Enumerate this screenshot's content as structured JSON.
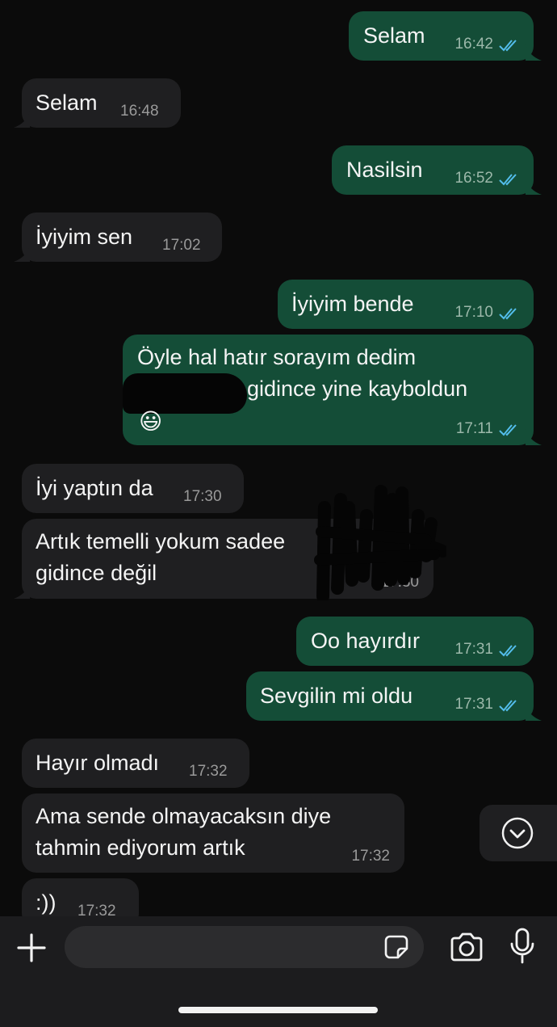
{
  "messages": [
    {
      "dir": "out",
      "text": "Selam",
      "time": "16:42"
    },
    {
      "dir": "in",
      "text": "Selam",
      "time": "16:48"
    },
    {
      "dir": "out",
      "text": "Nasilsin",
      "time": "16:52"
    },
    {
      "dir": "in",
      "text": "İyiyim sen",
      "time": "17:02"
    },
    {
      "dir": "out",
      "text": "İyiyim bende",
      "time": "17:10"
    },
    {
      "dir": "out",
      "line1": "Öyle hal hatır sorayım dedim",
      "line2": "gidince yine kayboldun",
      "emoji": "😃",
      "time": "17:11"
    },
    {
      "dir": "in",
      "text": "İyi yaptın da",
      "time": "17:30"
    },
    {
      "dir": "in",
      "line1": "Artık temelli yokum sadee",
      "line2": "gidince değil",
      "time": "17:30"
    },
    {
      "dir": "out",
      "text": "Oo hayırdır",
      "time": "17:31"
    },
    {
      "dir": "out",
      "text": "Sevgilin mi oldu",
      "time": "17:31"
    },
    {
      "dir": "in",
      "text": "Hayır olmadı",
      "time": "17:32"
    },
    {
      "dir": "in",
      "line1": "Ama sende olmayacaksın diye",
      "line2": "tahmin ediyorum artık",
      "time": "17:32"
    },
    {
      "dir": "in",
      "text": ":))",
      "time": "17:32"
    }
  ],
  "colors": {
    "background": "#0b0b0b",
    "incoming_bubble": "#1f1f21",
    "outgoing_bubble": "#144d37",
    "read_tick": "#53bdeb"
  },
  "icons": {
    "read": "double-check-icon",
    "scroll": "chevron-down-circle-icon",
    "attach": "plus-icon",
    "sticker": "sticker-icon",
    "camera": "camera-icon",
    "mic": "microphone-icon"
  },
  "composer": {
    "value": "",
    "placeholder": ""
  }
}
